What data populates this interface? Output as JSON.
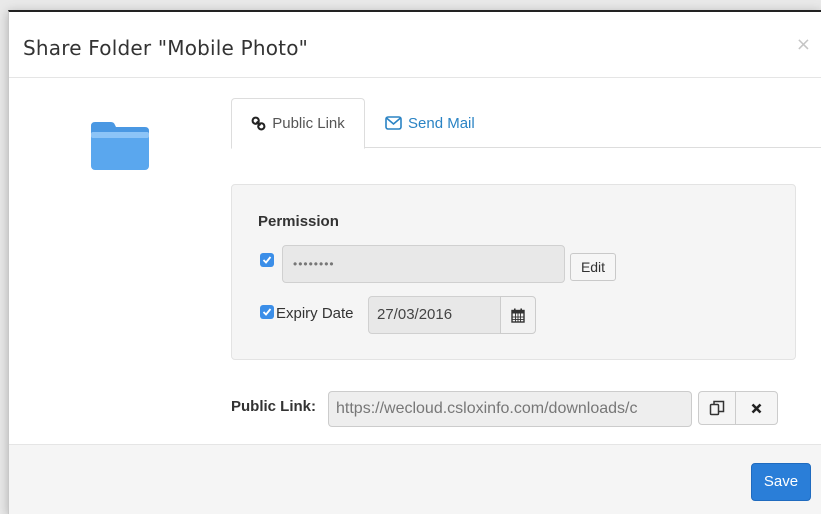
{
  "dialog": {
    "title": "Share Folder \"Mobile Photo\"",
    "close_glyph": "×"
  },
  "folder_icon": {
    "name": "folder-icon",
    "color": "#5aa7ee"
  },
  "tabs": [
    {
      "label": "Public Link",
      "icon": "link-icon",
      "active": true
    },
    {
      "label": "Send Mail",
      "icon": "envelope-icon",
      "active": false
    }
  ],
  "permission": {
    "title": "Permission",
    "password_checked": true,
    "password_value": "••••••••",
    "edit_label": "Edit",
    "expiry_checked": true,
    "expiry_label": "Expiry Date",
    "expiry_value": "27/03/2016",
    "calendar_icon": "calendar-icon"
  },
  "public_link": {
    "label": "Public Link:",
    "value": "https://wecloud.csloxinfo.com/downloads/c",
    "copy_icon": "copy-icon",
    "clear_icon": "times-icon"
  },
  "footer": {
    "save_label": "Save"
  },
  "colors": {
    "accent": "#2a7ed8",
    "link": "#2a83c4",
    "checkbox": "#3b8ee8"
  }
}
